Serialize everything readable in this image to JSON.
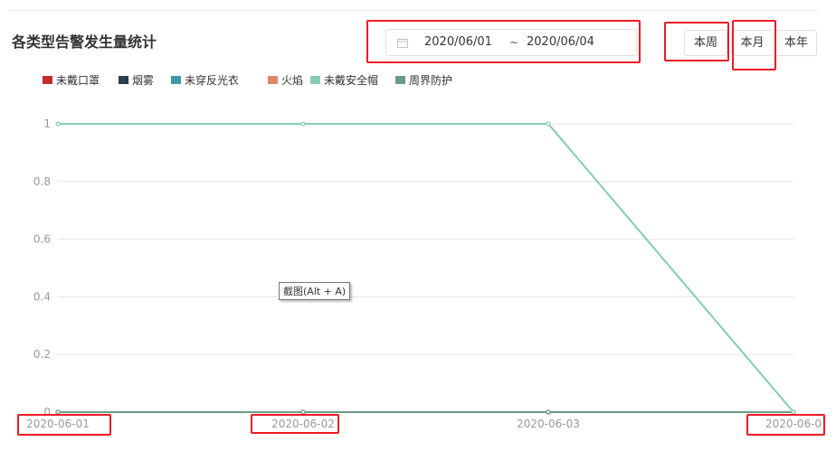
{
  "title": "各类型告警发生量统计",
  "date_range": {
    "start": "2020/06/01",
    "separator": "~",
    "end": "2020/06/04"
  },
  "buttons": {
    "week": "本周",
    "month": "本月",
    "year": "本年"
  },
  "tooltip": "截图(Alt + A)",
  "colors": {
    "highlight": "#ee1b24",
    "grid": "#e5e5e5",
    "axis_text": "#999999"
  },
  "chart_data": {
    "type": "line",
    "categories": [
      "2020-06-01",
      "2020-06-02",
      "2020-06-03",
      "2020-06-0"
    ],
    "ylim": [
      0,
      1
    ],
    "yticks": [
      "0",
      "0.2",
      "0.4",
      "0.6",
      "0.8",
      "1"
    ],
    "grid": true,
    "legend_position": "top-left",
    "series": [
      {
        "name": "未戴口罩",
        "color": "#c62d2d",
        "values": [
          0,
          0,
          0,
          0
        ]
      },
      {
        "name": "烟雾",
        "color": "#2b3d4f",
        "values": [
          0,
          0,
          0,
          0
        ]
      },
      {
        "name": "未穿反光衣",
        "color": "#3f9aa6",
        "values": [
          0,
          0,
          0,
          0
        ]
      },
      {
        "name": "火焰",
        "color": "#e0886a",
        "values": [
          0,
          0,
          0,
          0
        ]
      },
      {
        "name": "未戴安全帽",
        "color": "#85cbb2",
        "values": [
          1,
          1,
          1,
          0
        ]
      },
      {
        "name": "周界防护",
        "color": "#6a9b83",
        "values": [
          0,
          0,
          0,
          0
        ]
      }
    ]
  }
}
